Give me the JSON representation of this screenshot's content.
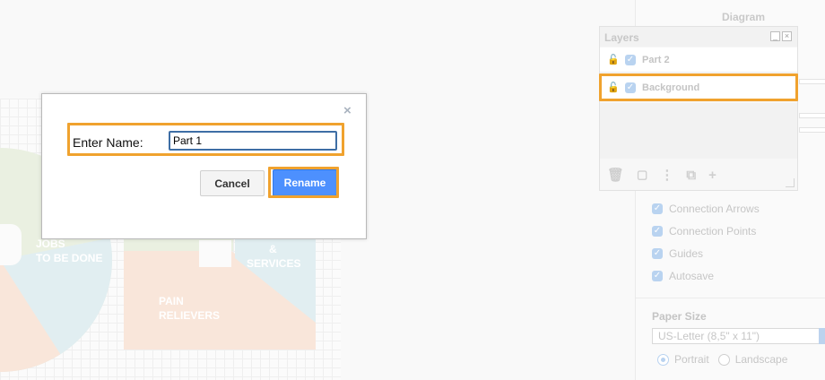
{
  "canvas": {
    "labels": {
      "jobs": "JOBS",
      "to_be_done": "TO BE DONE",
      "amp": "&",
      "services": "SERVICES",
      "pain": "PAIN",
      "relievers": "RELIEVERS"
    }
  },
  "format_panel": {
    "title": "Diagram",
    "options": [
      {
        "label": "Connection Arrows",
        "checked": true
      },
      {
        "label": "Connection Points",
        "checked": true
      },
      {
        "label": "Guides",
        "checked": true
      },
      {
        "label": "Autosave",
        "checked": true
      }
    ],
    "paper_size": {
      "title": "Paper Size",
      "selected": "US-Letter (8,5\" x 11\")"
    },
    "orientation": {
      "portrait": "Portrait",
      "landscape": "Landscape",
      "selected": "Portrait"
    }
  },
  "layers_window": {
    "title": "Layers",
    "layers": [
      {
        "name": "Part 2",
        "visible": true,
        "locked": false
      },
      {
        "name": "Background",
        "visible": true,
        "locked": false,
        "highlighted": true
      }
    ],
    "toolbar_icons": [
      "trash-icon",
      "move-selection-icon",
      "more-icon",
      "duplicate-icon",
      "add-icon"
    ]
  },
  "dialog": {
    "close": "×",
    "label": "Enter Name:",
    "input_value": "Part 1",
    "cancel": "Cancel",
    "rename": "Rename"
  },
  "colors": {
    "highlight": "#f0a22e",
    "primary_button": "#4d90fe"
  }
}
